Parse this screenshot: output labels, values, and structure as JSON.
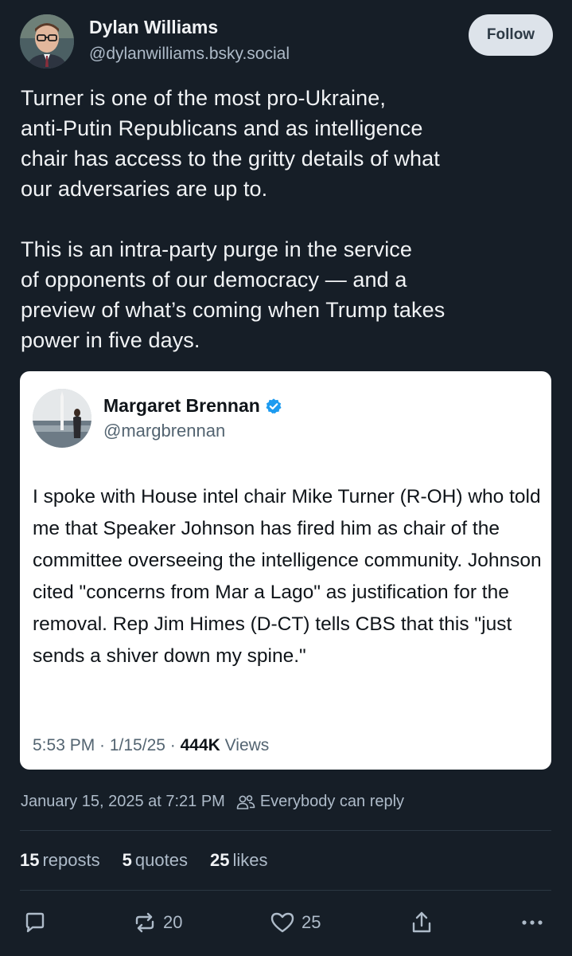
{
  "author": {
    "name": "Dylan Williams",
    "handle": "@dylanwilliams.bsky.social"
  },
  "follow_label": "Follow",
  "post": {
    "text": "Turner is one of the most pro-Ukraine,\nanti-Putin Republicans and as intelligence\nchair has access to the gritty details of what\nour adversaries are up to.\n\nThis is an intra-party purge in the service\nof opponents of our democracy — and a\npreview of what’s coming when Trump takes\npower in five days."
  },
  "quote": {
    "name": "Margaret Brennan",
    "handle": "@margbrennan",
    "text": "I spoke with House intel chair Mike Turner (R-OH) who told me that Speaker Johnson has fired him as chair of the committee overseeing the intelligence community. Johnson cited \"concerns from Mar a Lago\" as justification for the removal. Rep Jim Himes (D-CT) tells CBS that this \"just sends a shiver down my spine.\"",
    "time": "5:53 PM · 1/15/25 · ",
    "views_count": "444K",
    "views_label": " Views",
    "verified_color": "#1d9bf0"
  },
  "meta": {
    "timestamp": "January 15, 2025 at 7:21 PM",
    "reply_setting": "Everybody can reply"
  },
  "stats": {
    "reposts_count": "15",
    "reposts_label": "reposts",
    "quotes_count": "5",
    "quotes_label": "quotes",
    "likes_count": "25",
    "likes_label": "likes"
  },
  "actions": {
    "repost_count": "20",
    "like_count": "25"
  },
  "colors": {
    "background": "#161e27",
    "text_primary": "#f1f3f5",
    "text_secondary": "#aebbc9",
    "follow_bg": "#dde3ea"
  }
}
